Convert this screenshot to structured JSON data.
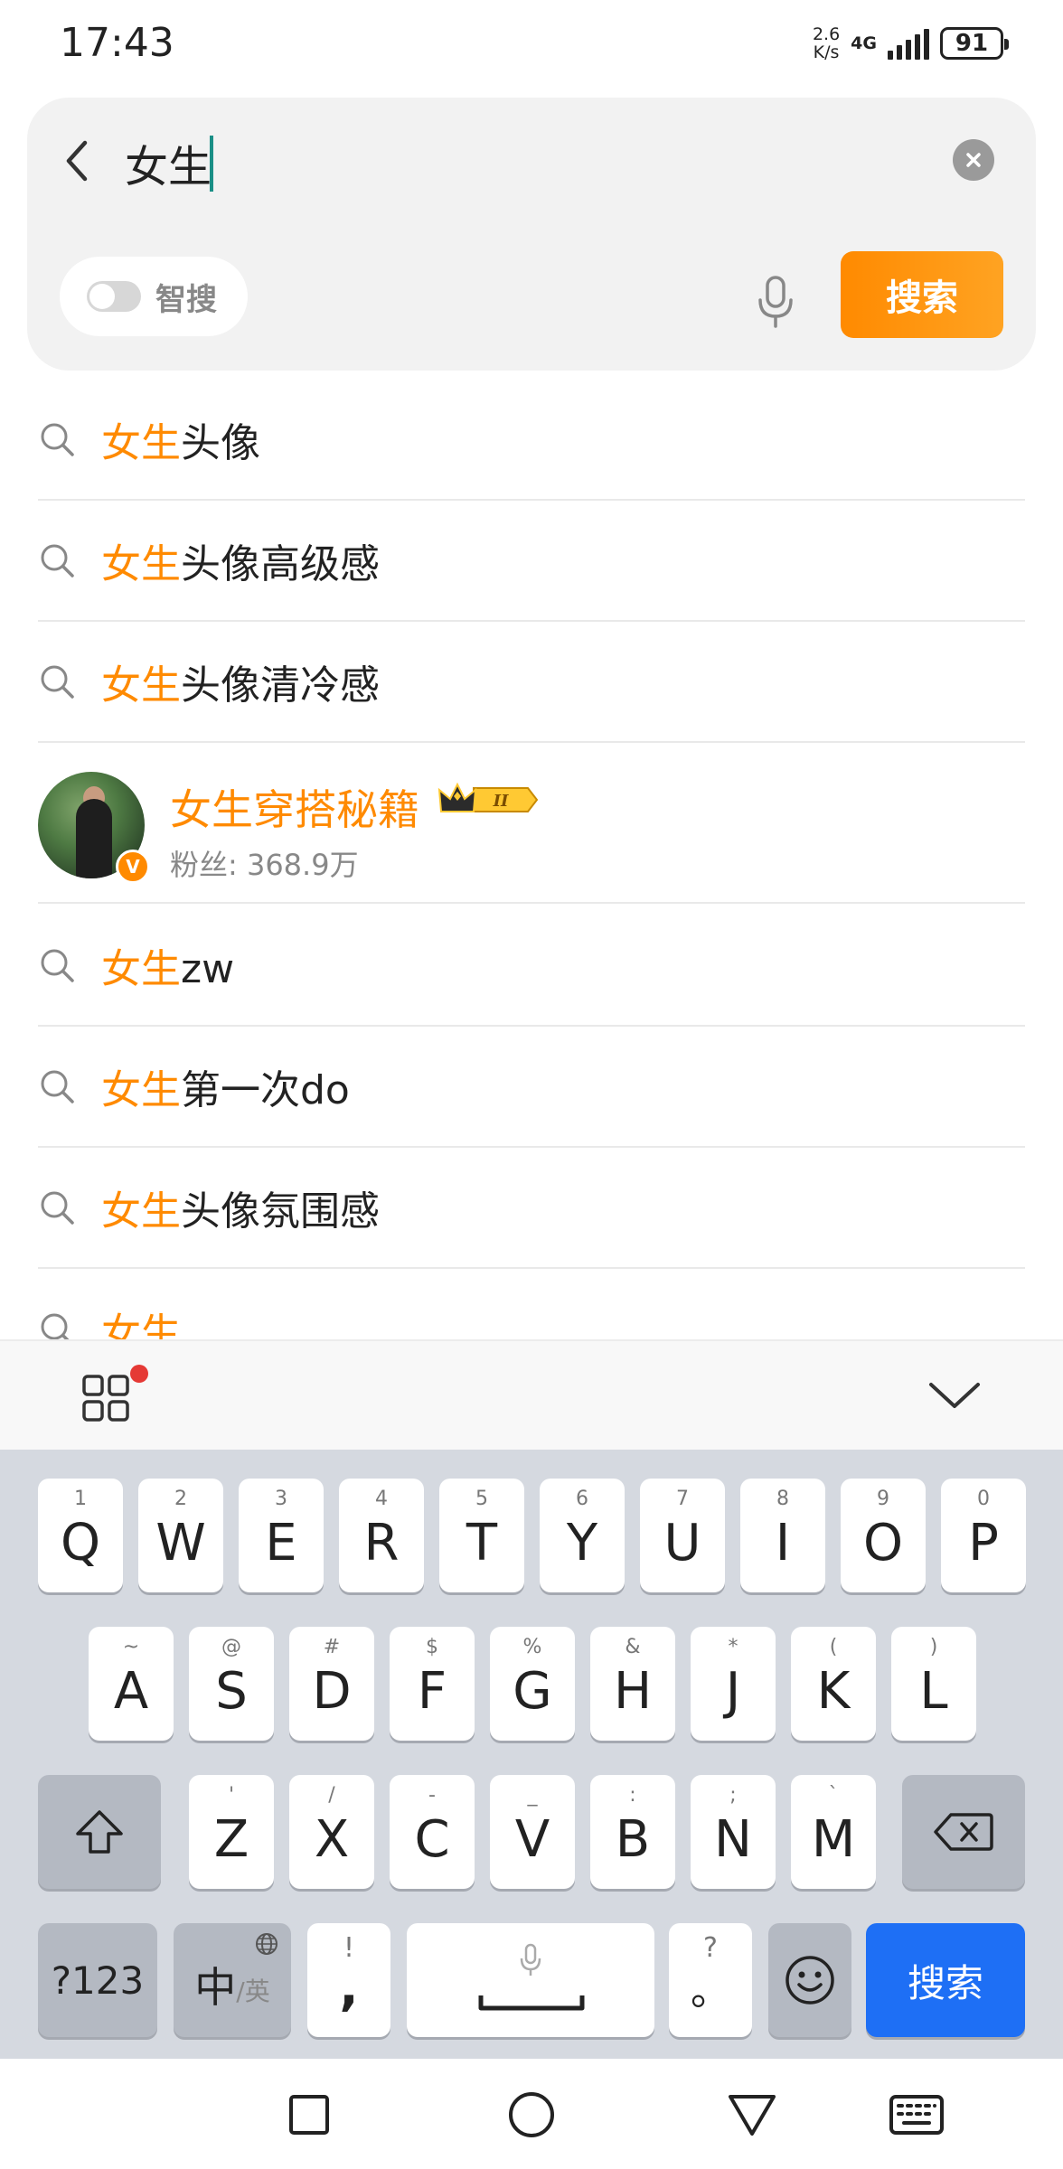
{
  "status_bar": {
    "time": "17:43",
    "net_speed_top": "2.6",
    "net_speed_bottom": "K/s",
    "network": "4G",
    "battery": "91"
  },
  "search": {
    "query": "女生",
    "smart_label": "智搜",
    "search_button": "搜索",
    "accent": "#ff8a00"
  },
  "suggestions": [
    {
      "highlight": "女生",
      "rest": "头像"
    },
    {
      "highlight": "女生",
      "rest": "头像高级感"
    },
    {
      "highlight": "女生",
      "rest": "头像清冷感"
    },
    {
      "highlight": "女生",
      "rest": "zw"
    },
    {
      "highlight": "女生",
      "rest": "第一次do"
    },
    {
      "highlight": "女生",
      "rest": "头像氛围感"
    },
    {
      "highlight": "女生",
      "rest": ""
    }
  ],
  "user_result": {
    "name": "女生穿搭秘籍",
    "level": "II",
    "fans": "粉丝: 368.9万",
    "verified_mark": "V"
  },
  "keyboard": {
    "row1": [
      {
        "key": "Q",
        "sub": "1"
      },
      {
        "key": "W",
        "sub": "2"
      },
      {
        "key": "E",
        "sub": "3"
      },
      {
        "key": "R",
        "sub": "4"
      },
      {
        "key": "T",
        "sub": "5"
      },
      {
        "key": "Y",
        "sub": "6"
      },
      {
        "key": "U",
        "sub": "7"
      },
      {
        "key": "I",
        "sub": "8"
      },
      {
        "key": "O",
        "sub": "9"
      },
      {
        "key": "P",
        "sub": "0"
      }
    ],
    "row2": [
      {
        "key": "A",
        "sub": "~"
      },
      {
        "key": "S",
        "sub": "@"
      },
      {
        "key": "D",
        "sub": "#"
      },
      {
        "key": "F",
        "sub": "$"
      },
      {
        "key": "G",
        "sub": "%"
      },
      {
        "key": "H",
        "sub": "&"
      },
      {
        "key": "J",
        "sub": "*"
      },
      {
        "key": "K",
        "sub": "("
      },
      {
        "key": "L",
        "sub": ")"
      }
    ],
    "row3": [
      {
        "key": "Z",
        "sub": "'"
      },
      {
        "key": "X",
        "sub": "/"
      },
      {
        "key": "C",
        "sub": "-"
      },
      {
        "key": "V",
        "sub": "_"
      },
      {
        "key": "B",
        "sub": ":"
      },
      {
        "key": "N",
        "sub": ";"
      },
      {
        "key": "M",
        "sub": "`"
      }
    ],
    "numbers_key": "?123",
    "lang_main": "中",
    "lang_sub": "/英",
    "comma_key": ",",
    "comma_sub": "!",
    "period_key": "。",
    "period_sub": "?",
    "enter_label": "搜索",
    "enter_color": "#1e6ff5"
  },
  "icons": {
    "back": "chevron-left-icon",
    "clear": "close-circle-icon",
    "mic": "microphone-icon",
    "search": "magnifier-icon",
    "apps": "grid-icon",
    "collapse": "chevron-down-icon",
    "shift": "shift-icon",
    "backspace": "backspace-icon",
    "emoji": "emoji-icon",
    "globe": "globe-icon"
  }
}
